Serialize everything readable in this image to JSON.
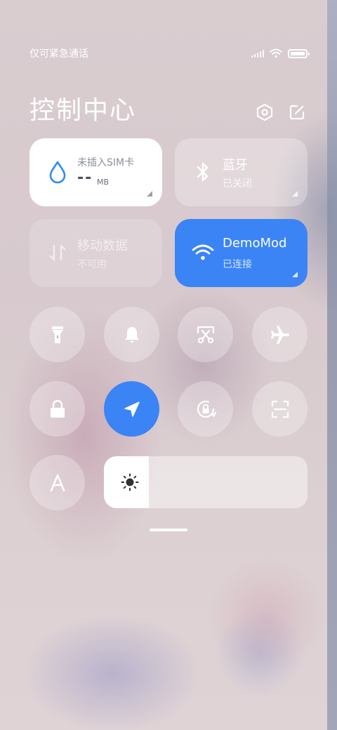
{
  "status_bar": {
    "carrier_text": "仅可紧急通话",
    "icons": [
      "signal-icon",
      "wifi-icon",
      "battery-icon"
    ]
  },
  "header": {
    "title": "控制中心",
    "settings_icon": "settings-hexagon-icon",
    "edit_icon": "edit-icon"
  },
  "tiles": {
    "data_usage": {
      "label": "未插入SIM卡",
      "value": "--",
      "unit": "MB",
      "icon": "water-drop-icon"
    },
    "bluetooth": {
      "title": "蓝牙",
      "status": "已关闭",
      "icon": "bluetooth-icon"
    },
    "mobile_data": {
      "title": "移动数据",
      "status": "不可用",
      "icon": "data-arrows-icon"
    },
    "wifi": {
      "title": "DemoMod",
      "status": "已连接",
      "icon": "wifi-icon"
    }
  },
  "toggles": [
    {
      "name": "flashlight",
      "icon": "flashlight-icon",
      "active": false
    },
    {
      "name": "silent",
      "icon": "bell-icon",
      "active": false
    },
    {
      "name": "screenshot",
      "icon": "screenshot-scissors-icon",
      "active": false
    },
    {
      "name": "airplane",
      "icon": "airplane-icon",
      "active": false
    },
    {
      "name": "lock-screen",
      "icon": "lock-icon",
      "active": false
    },
    {
      "name": "location",
      "icon": "location-arrow-icon",
      "active": true
    },
    {
      "name": "rotation-lock",
      "icon": "rotation-lock-icon",
      "active": false
    },
    {
      "name": "scanner",
      "icon": "scan-icon",
      "active": false
    },
    {
      "name": "auto-brightness",
      "icon": "letter-a-icon",
      "label": "A",
      "active": false
    }
  ],
  "brightness": {
    "level": 0.22,
    "icon": "sun-icon"
  },
  "colors": {
    "accent": "#3b84f5",
    "tile_bg": "#ffffff"
  }
}
